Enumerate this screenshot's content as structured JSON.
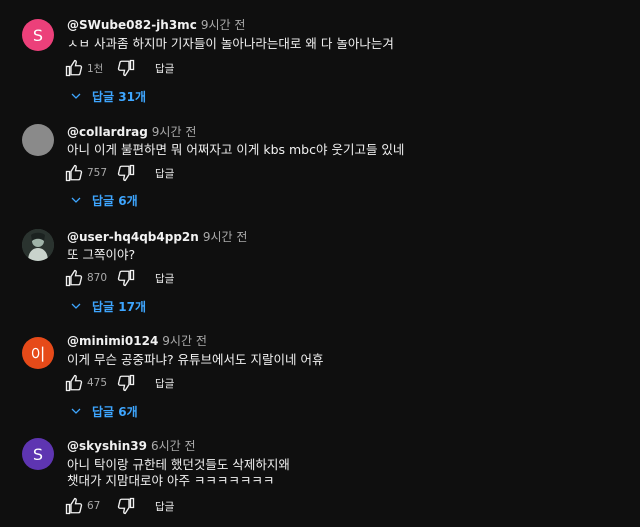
{
  "reply_label": "답글",
  "comments": [
    {
      "avatar_letter": "S",
      "avatar_color": "#ec407a",
      "author": "@SWube082-jh3mc",
      "time": "9시간 전",
      "text": [
        "ㅅㅂ 사과좀 하지마 기자들이 놀아나라는대로 왜 다 놀아나는겨"
      ],
      "likes": "1천",
      "replies": "답글 31개"
    },
    {
      "avatar_letter": "",
      "avatar_color": "#8a8a8a",
      "author": "@collardrag",
      "time": "9시간 전",
      "text": [
        "아니 이게 불편하면 뭐 어쩌자고 이게 kbs mbc야  웃기고들 있네"
      ],
      "likes": "757",
      "replies": "답글 6개"
    },
    {
      "avatar_letter": "",
      "avatar_color": "#3c4a45",
      "author": "@user-hq4qb4pp2n",
      "time": "9시간 전",
      "text": [
        "또 그쪽이야?"
      ],
      "likes": "870",
      "replies": "답글 17개"
    },
    {
      "avatar_letter": "이",
      "avatar_color": "#e64a19",
      "author": "@minimi0124",
      "time": "9시간 전",
      "text": [
        "이게 무슨 공중파냐? 유튜브에서도 지랄이네 어휴"
      ],
      "likes": "475",
      "replies": "답글 6개"
    },
    {
      "avatar_letter": "S",
      "avatar_color": "#5e35b1",
      "author": "@skyshin39",
      "time": "6시간 전",
      "text": [
        "아니 탁이랑 규한테 했던것들도 삭제하지왜",
        "챗대가 지맘대로야 아주 ㅋㅋㅋㅋㅋㅋㅋ"
      ],
      "likes": "67",
      "replies": ""
    }
  ]
}
